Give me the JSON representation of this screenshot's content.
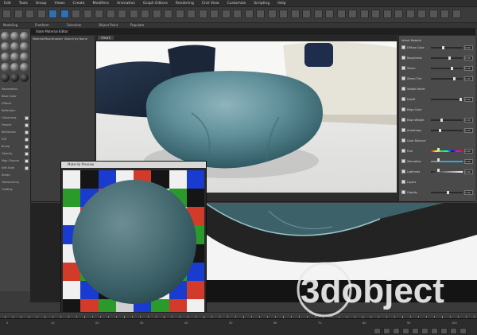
{
  "menu": {
    "items": [
      "Edit",
      "Tools",
      "Group",
      "Views",
      "Create",
      "Modifiers",
      "Animation",
      "Graph Editors",
      "Rendering",
      "Civil View",
      "Customize",
      "Scripting",
      "Help"
    ]
  },
  "ribbon": {
    "items": [
      "Modeling",
      "Freeform",
      "Selection",
      "Object Paint",
      "Populate"
    ]
  },
  "slate": {
    "title": "Slate Material Editor",
    "view_tab": "View1",
    "left_headers": [
      "Material/Map Browser",
      "Search by Name"
    ],
    "render_title": "Render Setup"
  },
  "left_panel": {
    "rows": [
      "Parameters",
      "Base Color",
      "Diffuse",
      "Reflection",
      "Glossiness",
      "Fresnel",
      "Refraction",
      "IOR",
      "Bump",
      "Opacity",
      "Map Channel",
      "Self-Illum",
      "Sheen",
      "Translucency",
      "Coating"
    ]
  },
  "params": {
    "header": "Velvet Material",
    "rows": [
      {
        "label": "Diffuse Color",
        "value": "0.80",
        "level": 0.35
      },
      {
        "label": "Roughness",
        "value": "0.30",
        "level": 0.55
      },
      {
        "label": "Sheen",
        "value": "0.45",
        "level": 0.62
      },
      {
        "label": "Sheen Tint",
        "value": "1.00",
        "level": 0.7
      },
      {
        "label": "Visible Velvet",
        "value": "",
        "level": 0
      },
      {
        "label": "Falloff",
        "value": "0.60",
        "level": 0.9
      },
      {
        "label": "Edge Color",
        "value": "",
        "level": 0
      },
      {
        "label": "Edge Weight",
        "value": "0.30",
        "level": 0.3
      },
      {
        "label": "Anisotropy",
        "value": "0.25",
        "level": 0.25
      },
      {
        "label": "Color Balance",
        "value": "",
        "level": 0
      },
      {
        "label": "Hue",
        "value": "0.00",
        "level": 0.5
      },
      {
        "label": "Saturation",
        "value": "0.00",
        "level": 0.5
      },
      {
        "label": "Lightness",
        "value": "0.00",
        "level": 0.5
      },
      {
        "label": "Layers",
        "value": "",
        "level": 0
      },
      {
        "label": "Opacity",
        "value": "1.00",
        "level": 0.5
      }
    ]
  },
  "preview": {
    "title": "Material Preview"
  },
  "status": {
    "time_labels": [
      "0",
      "10",
      "20",
      "30",
      "40",
      "50",
      "60",
      "70",
      "80",
      "90",
      "100"
    ]
  },
  "watermark": {
    "text": "3dobject"
  },
  "colors": {
    "sphere": "#4f7379",
    "checker": [
      "#2a9a2a",
      "#1a3bd0",
      "#d23a2a",
      "#f0f0f0",
      "#151515",
      "#cfcfcf"
    ]
  }
}
